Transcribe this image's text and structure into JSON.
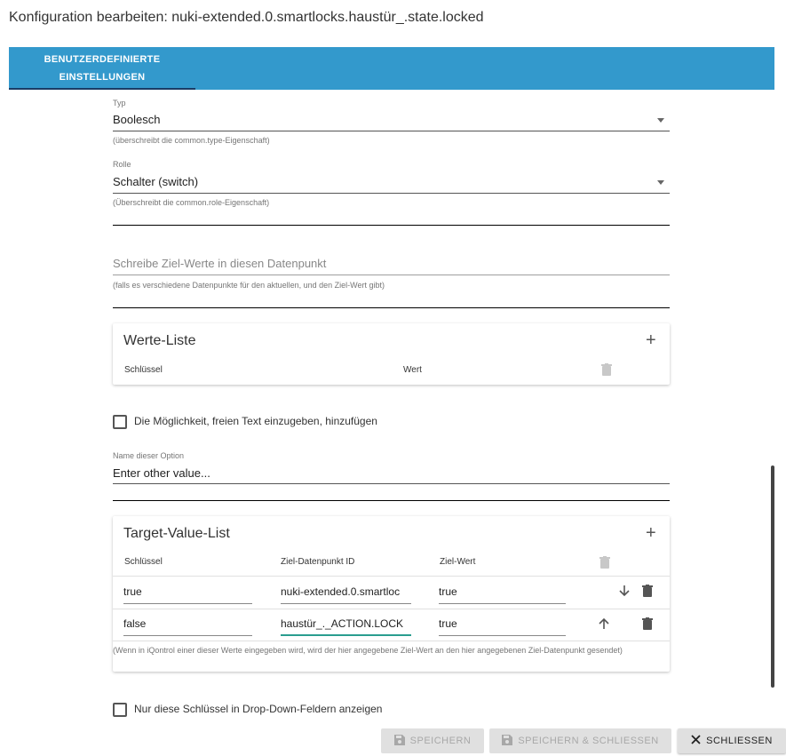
{
  "dialog": {
    "title": "Konfiguration bearbeiten: nuki-extended.0.smartlocks.haustür_.state.locked"
  },
  "tabs": [
    {
      "line1": "BENUTZERDEFINIERTE",
      "line2": "EINSTELLUNGEN"
    }
  ],
  "form": {
    "type": {
      "label": "Typ",
      "value": "Boolesch",
      "helper": "(überschreibt die common.type-Eigenschaft)"
    },
    "role": {
      "label": "Rolle",
      "value": "Schalter (switch)",
      "helper": "(Überschreibt die common.role-Eigenschaft)"
    },
    "target_datapoint": {
      "placeholder": "Schreibe Ziel-Werte in diesen Datenpunkt",
      "helper": "(falls es verschiedene Datenpunkte für den aktuellen, und den Ziel-Wert gibt)"
    },
    "values_list": {
      "title": "Werte-Liste",
      "add_icon": "plus-icon",
      "columns": [
        "Schlüssel",
        "Wert"
      ],
      "delete_icon": "trash-icon"
    },
    "free_text": {
      "checkbox_label": "Die Möglichkeit, freien Text einzugeben, hinzufügen",
      "checked": false
    },
    "option_name": {
      "label": "Name dieser Option",
      "value": "Enter other value..."
    },
    "target_value_list": {
      "title": "Target-Value-List",
      "add_icon": "plus-icon",
      "columns": [
        "Schlüssel",
        "Ziel-Datenpunkt ID",
        "Ziel-Wert"
      ],
      "rows": [
        {
          "key": "true",
          "datapoint": "nuki-extended.0.smartloc",
          "value": "true",
          "move_icon": "arrow-down-icon"
        },
        {
          "key": "false",
          "datapoint": "haustür_._ACTION.LOCK",
          "value": "true",
          "move_icon": "arrow-up-icon"
        }
      ],
      "helper": "(Wenn in iQontrol einer dieser Werte eingegeben wird, wird der hier angegebene Ziel-Wert an den hier angegebenen Ziel-Datenpunkt gesendet)"
    },
    "only_keys": {
      "checkbox_label": "Nur diese Schlüssel in Drop-Down-Feldern anzeigen",
      "checked": false
    }
  },
  "actions": {
    "save": "SPEICHERN",
    "save_close": "SPEICHERN & SCHLIESSEN",
    "close": "SCHLIESSEN"
  },
  "colors": {
    "tab_bar": "#3399cc",
    "tab_indicator": "#1a3d66",
    "active_underline": "#2a9d8f"
  }
}
